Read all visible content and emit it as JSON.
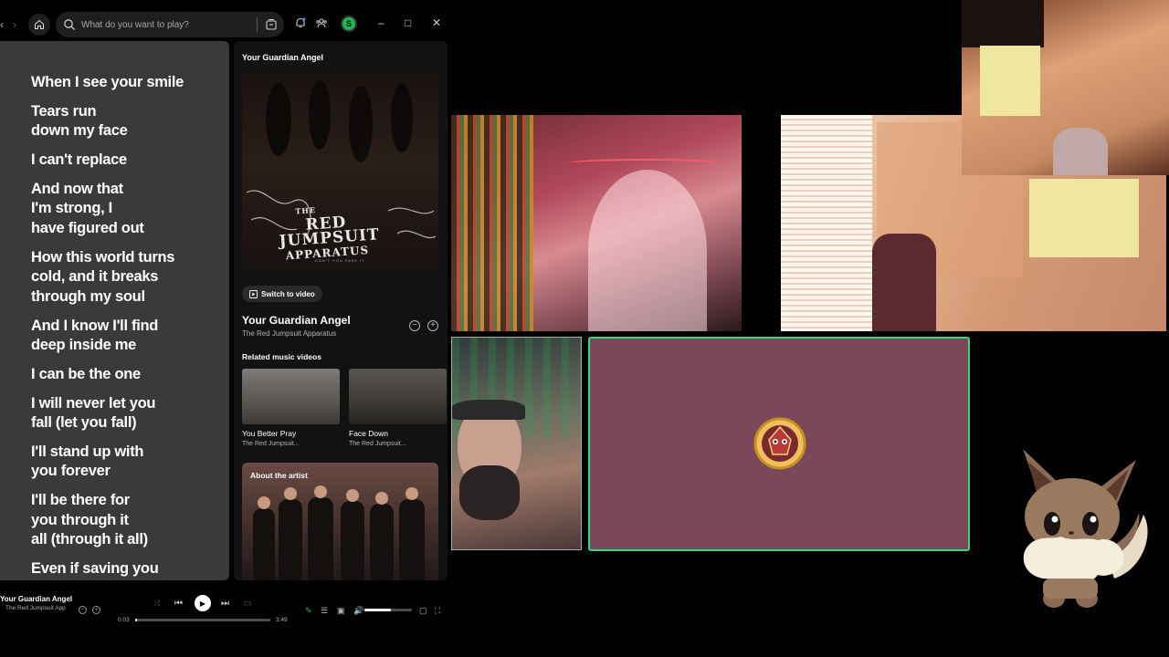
{
  "search": {
    "placeholder": "What do you want to play?"
  },
  "user": {
    "avatar_initial": "S"
  },
  "lyrics": [
    "When I see your smile",
    "Tears run",
    "down my face",
    "I can't replace",
    "And now that",
    "I'm strong, I",
    "have figured out",
    "How this world turns",
    "cold, and it breaks",
    "through my soul",
    "And I know I'll find",
    "deep inside me",
    "I can be the one",
    "I will never let you",
    "fall (let you fall)",
    "I'll stand up with",
    "you forever",
    "I'll be there for",
    "you through it",
    "all (through it all)",
    "Even if saving you"
  ],
  "now_playing": {
    "header": "Your Guardian Angel",
    "art_text_line1": "THE",
    "art_text_line2": "RED",
    "art_text_line3": "JUMPSUIT",
    "art_text_line4": "APPARATUS",
    "art_subtext": "DON'T YOU FAKE IT",
    "switch_label": "Switch to video",
    "title": "Your Guardian Angel",
    "artist": "The Red Jumpsuit Apparatus",
    "related_header": "Related music videos",
    "related": [
      {
        "title": "You Better Pray",
        "artist": "The Red Jumpsuit..."
      },
      {
        "title": "Face Down",
        "artist": "The Red Jumpsuit..."
      }
    ],
    "about_label": "About the artist"
  },
  "player": {
    "title": "Your Guardian Angel",
    "artist": "The Red Jumpsuit App",
    "elapsed": "0:03",
    "duration": "3:49",
    "progress": 0.013,
    "volume": 0.55
  },
  "colors": {
    "spotify_green": "#1db954",
    "lyrics_bg": "#3a3a3a",
    "active_speaker_border": "#3ad47a",
    "avatar_tile_bg": "#7a4858"
  }
}
